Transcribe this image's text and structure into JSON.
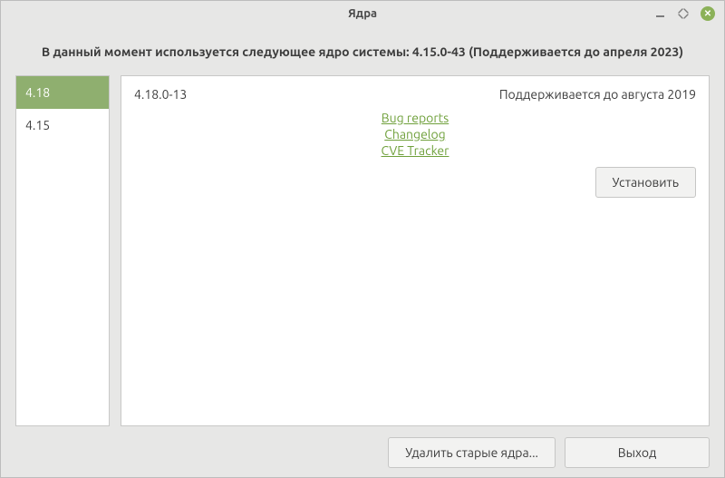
{
  "window": {
    "title": "Ядра"
  },
  "banner": "В данный момент используется следующее ядро системы: 4.15.0-43 (Поддерживается до апреля 2023)",
  "sidebar": {
    "items": [
      {
        "label": "4.18",
        "selected": true
      },
      {
        "label": "4.15",
        "selected": false
      }
    ]
  },
  "details": {
    "version": "4.18.0-13",
    "support_text": "Поддерживается до августа 2019",
    "links": {
      "bug_reports": "Bug reports",
      "changelog": "Changelog",
      "cve_tracker": "CVE Tracker"
    },
    "install_label": "Установить"
  },
  "footer": {
    "remove_old_label": "Удалить старые ядра...",
    "exit_label": "Выход"
  }
}
